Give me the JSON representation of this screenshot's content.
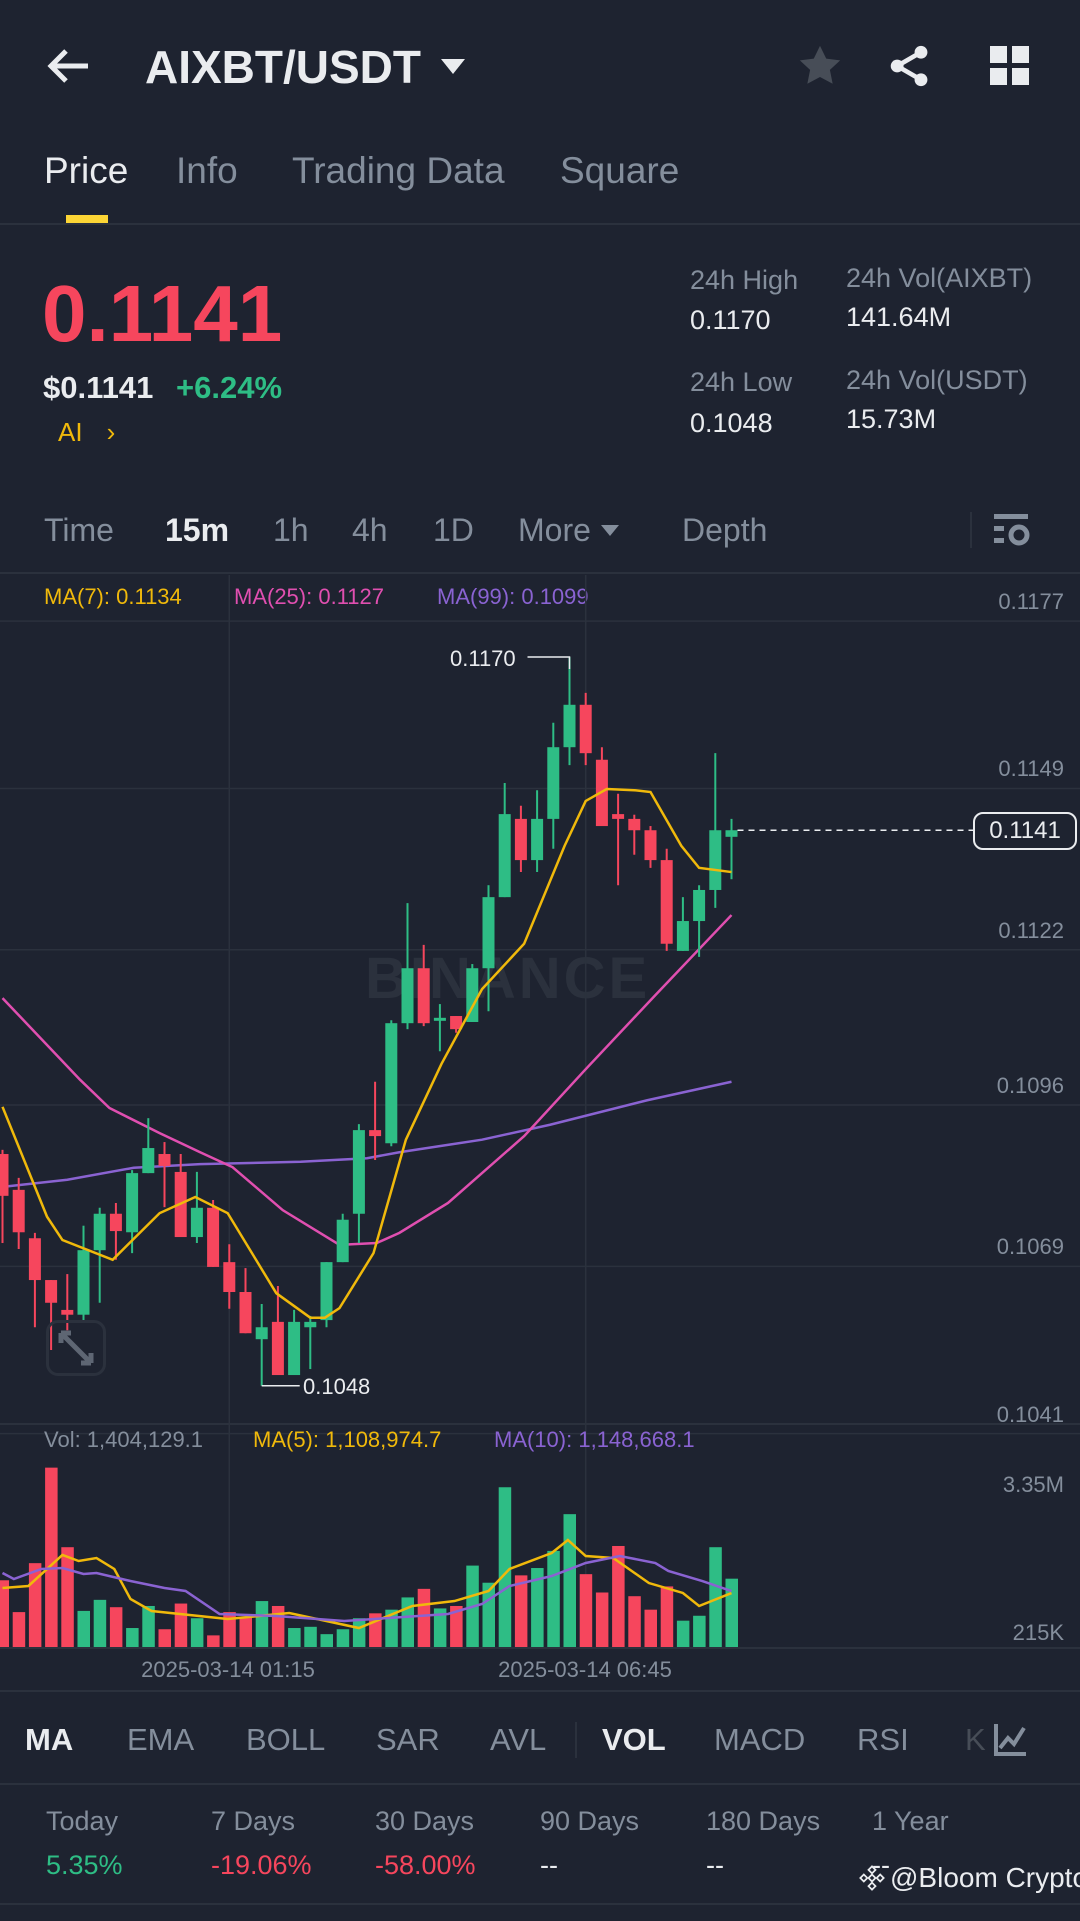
{
  "header": {
    "title": "AIXBT/USDT"
  },
  "tabs": [
    {
      "label": "Price"
    },
    {
      "label": "Info"
    },
    {
      "label": "Trading Data"
    },
    {
      "label": "Square"
    }
  ],
  "price": {
    "last": "0.1141",
    "usd": "$0.1141",
    "change": "+6.24%",
    "ai_label": "AI",
    "high_label": "24h High",
    "high": "0.1170",
    "low_label": "24h Low",
    "low": "0.1048",
    "vol_base_label": "24h Vol(AIXBT)",
    "vol_base": "141.64M",
    "vol_quote_label": "24h Vol(USDT)",
    "vol_quote": "15.73M"
  },
  "timeframes": [
    {
      "label": "Time"
    },
    {
      "label": "15m"
    },
    {
      "label": "1h"
    },
    {
      "label": "4h"
    },
    {
      "label": "1D"
    },
    {
      "label": "More"
    },
    {
      "label": "Depth"
    }
  ],
  "ma_legend": {
    "ma7": "MA(7): 0.1134",
    "ma25": "MA(25): 0.1127",
    "ma99": "MA(99): 0.1099"
  },
  "vol_legend": {
    "vol": "Vol: 1,404,129.1",
    "ma5": "MA(5): 1,108,974.7",
    "ma10": "MA(10): 1,148,668.1"
  },
  "watermark": "BINANCE",
  "indicators": [
    {
      "label": "MA"
    },
    {
      "label": "EMA"
    },
    {
      "label": "BOLL"
    },
    {
      "label": "SAR"
    },
    {
      "label": "AVL"
    },
    {
      "label": "VOL"
    },
    {
      "label": "MACD"
    },
    {
      "label": "RSI"
    },
    {
      "label": "K"
    }
  ],
  "performance": [
    {
      "label": "Today",
      "value": "5.35%"
    },
    {
      "label": "7 Days",
      "value": "-19.06%"
    },
    {
      "label": "30 Days",
      "value": "-58.00%"
    },
    {
      "label": "90 Days",
      "value": "--"
    },
    {
      "label": "180 Days",
      "value": "--"
    },
    {
      "label": "1 Year",
      "value": "--"
    }
  ],
  "credit": "@Bloom Crypto",
  "colors": {
    "up": "#2ebd85",
    "down": "#f6465d",
    "accent": "#f0b90b",
    "ma7": "#f0b90b",
    "ma25": "#e04fb0",
    "ma99": "#8a63d2"
  },
  "chart_data": {
    "type": "candlestick",
    "interval": "15m",
    "price_ticks": [
      "0.1177",
      "0.1149",
      "0.1122",
      "0.1096",
      "0.1069",
      "0.1041"
    ],
    "volume_ticks": [
      "3.35M",
      "215K"
    ],
    "time_ticks": [
      {
        "label": "2025-03-14 01:15",
        "index": 14
      },
      {
        "label": "2025-03-14 06:45",
        "index": 36
      }
    ],
    "current_price": "0.1141",
    "high_marker": {
      "label": "0.1170",
      "index": 35,
      "value": 0.117
    },
    "low_marker": {
      "label": "0.1048",
      "index": 16,
      "value": 0.1048
    },
    "ohlc": [
      [
        0.10868,
        0.10875,
        0.10719,
        0.10798
      ],
      [
        0.10808,
        0.10828,
        0.10709,
        0.10737
      ],
      [
        0.10727,
        0.10736,
        0.10578,
        0.10657
      ],
      [
        0.10657,
        0.10657,
        0.1054,
        0.10619
      ],
      [
        0.10607,
        0.10667,
        0.10573,
        0.10599
      ],
      [
        0.10599,
        0.10748,
        0.1059,
        0.10707
      ],
      [
        0.10707,
        0.10778,
        0.10619,
        0.10768
      ],
      [
        0.10768,
        0.10786,
        0.10691,
        0.10739
      ],
      [
        0.10737,
        0.10841,
        0.10702,
        0.10836
      ],
      [
        0.10836,
        0.10928,
        0.10836,
        0.10878
      ],
      [
        0.10868,
        0.10888,
        0.10779,
        0.10848
      ],
      [
        0.10838,
        0.10868,
        0.10729,
        0.10729
      ],
      [
        0.10729,
        0.10838,
        0.10719,
        0.10778
      ],
      [
        0.10778,
        0.10791,
        0.10679,
        0.10679
      ],
      [
        0.10687,
        0.10717,
        0.10609,
        0.10637
      ],
      [
        0.10637,
        0.10677,
        0.10568,
        0.10568
      ],
      [
        0.10558,
        0.10617,
        0.1048,
        0.10578
      ],
      [
        0.10587,
        0.10647,
        0.10498,
        0.10498
      ],
      [
        0.10498,
        0.10607,
        0.10498,
        0.10587
      ],
      [
        0.10578,
        0.10597,
        0.10508,
        0.10587
      ],
      [
        0.1059,
        0.10687,
        0.10578,
        0.10687
      ],
      [
        0.10687,
        0.10768,
        0.10687,
        0.10758
      ],
      [
        0.10768,
        0.10918,
        0.10719,
        0.10908
      ],
      [
        0.10908,
        0.10989,
        0.10858,
        0.10898
      ],
      [
        0.10886,
        0.11092,
        0.10881,
        0.11087
      ],
      [
        0.11087,
        0.11288,
        0.11077,
        0.11179
      ],
      [
        0.11179,
        0.11218,
        0.11082,
        0.11087
      ],
      [
        0.11092,
        0.11119,
        0.1104,
        0.11096
      ],
      [
        0.11099,
        0.11099,
        0.11071,
        0.11077
      ],
      [
        0.11089,
        0.11186,
        0.11089,
        0.11179
      ],
      [
        0.11179,
        0.11318,
        0.11107,
        0.11298
      ],
      [
        0.11298,
        0.11489,
        0.11298,
        0.11437
      ],
      [
        0.11429,
        0.11451,
        0.1134,
        0.1136
      ],
      [
        0.1136,
        0.11477,
        0.1134,
        0.11429
      ],
      [
        0.11429,
        0.1159,
        0.11379,
        0.11549
      ],
      [
        0.11549,
        0.117,
        0.11519,
        0.1162
      ],
      [
        0.1162,
        0.1164,
        0.11519,
        0.11539
      ],
      [
        0.11528,
        0.11549,
        0.11417,
        0.11417
      ],
      [
        0.11437,
        0.11471,
        0.11318,
        0.11429
      ],
      [
        0.11429,
        0.11436,
        0.11369,
        0.1141
      ],
      [
        0.1141,
        0.11417,
        0.11347,
        0.1136
      ],
      [
        0.1136,
        0.11379,
        0.11208,
        0.1122
      ],
      [
        0.11208,
        0.11298,
        0.11208,
        0.11258
      ],
      [
        0.11258,
        0.11318,
        0.11198,
        0.1131
      ],
      [
        0.1131,
        0.11539,
        0.1128,
        0.1141
      ],
      [
        0.11399,
        0.11429,
        0.11328,
        0.1141
      ]
    ],
    "volume_millions": [
      1.371,
      0.717,
      1.723,
      3.686,
      2.051,
      0.742,
      0.969,
      0.818,
      0.39,
      0.843,
      0.365,
      0.893,
      0.591,
      0.239,
      0.717,
      0.616,
      0.944,
      0.843,
      0.39,
      0.415,
      0.264,
      0.365,
      0.591,
      0.692,
      0.767,
      1.019,
      1.195,
      0.793,
      0.843,
      1.673,
      1.321,
      3.283,
      1.472,
      1.623,
      1.975,
      2.73,
      1.497,
      1.12,
      2.076,
      1.044,
      0.767,
      1.245,
      0.541,
      0.642,
      2.051,
      1.404
    ],
    "ma7": [
      [
        0,
        0.10947
      ],
      [
        2.75,
        0.10763
      ],
      [
        3.7,
        0.10724
      ],
      [
        6.8,
        0.10691
      ],
      [
        9.7,
        0.10769
      ],
      [
        11.9,
        0.10796
      ],
      [
        13.9,
        0.10769
      ],
      [
        16.9,
        0.10635
      ],
      [
        19,
        0.10594
      ],
      [
        19.9,
        0.10594
      ],
      [
        20.8,
        0.1061
      ],
      [
        22.9,
        0.10702
      ],
      [
        24.9,
        0.10892
      ],
      [
        27.1,
        0.11019
      ],
      [
        29.6,
        0.11144
      ],
      [
        32.2,
        0.1122
      ],
      [
        34.7,
        0.11384
      ],
      [
        36,
        0.11459
      ],
      [
        37.3,
        0.11479
      ],
      [
        39,
        0.11477
      ],
      [
        40,
        0.11474
      ],
      [
        41.9,
        0.11384
      ],
      [
        43,
        0.11347
      ],
      [
        45,
        0.1134
      ]
    ],
    "ma25": [
      [
        0,
        0.11129
      ],
      [
        4.8,
        0.10992
      ],
      [
        6.6,
        0.10945
      ],
      [
        9.7,
        0.10903
      ],
      [
        12.2,
        0.10871
      ],
      [
        14.2,
        0.10846
      ],
      [
        17.3,
        0.10774
      ],
      [
        20.8,
        0.10716
      ],
      [
        23.1,
        0.10719
      ],
      [
        24.5,
        0.10736
      ],
      [
        27.5,
        0.10786
      ],
      [
        32.2,
        0.10898
      ],
      [
        36,
        0.1101
      ],
      [
        40.3,
        0.11134
      ],
      [
        45,
        0.11268
      ]
    ],
    "ma99": [
      [
        0,
        0.10813
      ],
      [
        4,
        0.10825
      ],
      [
        8.1,
        0.10845
      ],
      [
        12.2,
        0.10851
      ],
      [
        18.4,
        0.10855
      ],
      [
        22.5,
        0.10861
      ],
      [
        24.5,
        0.10871
      ],
      [
        29.6,
        0.10892
      ],
      [
        33.8,
        0.10917
      ],
      [
        39.8,
        0.10958
      ],
      [
        45,
        0.10989
      ]
    ],
    "vol_ma5": [
      [
        0,
        1.212
      ],
      [
        1.6,
        1.254
      ],
      [
        3.7,
        1.891
      ],
      [
        4.7,
        1.767
      ],
      [
        5.8,
        1.829
      ],
      [
        6.9,
        1.603
      ],
      [
        7.9,
        0.986
      ],
      [
        9.2,
        0.74
      ],
      [
        13.9,
        0.575
      ],
      [
        17.7,
        0.699
      ],
      [
        22,
        0.39
      ],
      [
        25.3,
        0.843
      ],
      [
        27.9,
        0.945
      ],
      [
        30,
        1.151
      ],
      [
        31.3,
        1.603
      ],
      [
        33.9,
        1.932
      ],
      [
        34.9,
        2.199
      ],
      [
        36,
        1.87
      ],
      [
        37.7,
        1.829
      ],
      [
        39.9,
        1.315
      ],
      [
        42,
        1.11
      ],
      [
        43,
        0.843
      ],
      [
        45,
        1.109
      ]
    ],
    "vol_ma10": [
      [
        0,
        1.521
      ],
      [
        0.7,
        1.397
      ],
      [
        2.4,
        1.603
      ],
      [
        3.7,
        1.623
      ],
      [
        5,
        1.5
      ],
      [
        5.8,
        1.521
      ],
      [
        7.9,
        1.356
      ],
      [
        10,
        1.212
      ],
      [
        11.3,
        1.151
      ],
      [
        13.4,
        0.678
      ],
      [
        16.9,
        0.637
      ],
      [
        21.1,
        0.534
      ],
      [
        27.5,
        0.678
      ],
      [
        29.6,
        0.884
      ],
      [
        31.3,
        1.254
      ],
      [
        33.9,
        1.459
      ],
      [
        36,
        1.726
      ],
      [
        38.1,
        1.87
      ],
      [
        40.3,
        1.726
      ],
      [
        41.1,
        1.562
      ],
      [
        43.2,
        1.356
      ],
      [
        45,
        1.149
      ]
    ]
  }
}
